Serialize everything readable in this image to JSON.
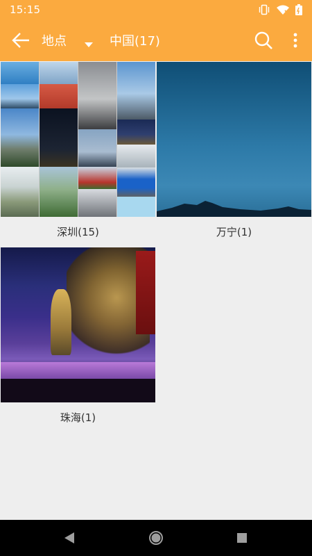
{
  "status_bar": {
    "time": "15:15",
    "icons": [
      "vibrate-icon",
      "wifi-icon",
      "battery-icon"
    ]
  },
  "toolbar": {
    "back_icon": "arrow-back-icon",
    "spinner_label": "地点",
    "spinner_icon": "dropdown-caret-icon",
    "breadcrumb": "中国(17)",
    "search_icon": "search-icon",
    "more_icon": "more-vert-icon"
  },
  "albums": [
    {
      "label": "深圳(15)",
      "cover": "collage"
    },
    {
      "label": "万宁(1)",
      "cover": "sky-over-mountains"
    },
    {
      "label": "珠海(1)",
      "cover": "stage-performance"
    }
  ],
  "nav_bar": {
    "back_icon": "nav-back-icon",
    "home_icon": "nav-home-icon",
    "recents_icon": "nav-recents-icon"
  },
  "colors": {
    "accent": "#fbaa3f",
    "background": "#eeeeee",
    "nav_bar": "#000000"
  }
}
